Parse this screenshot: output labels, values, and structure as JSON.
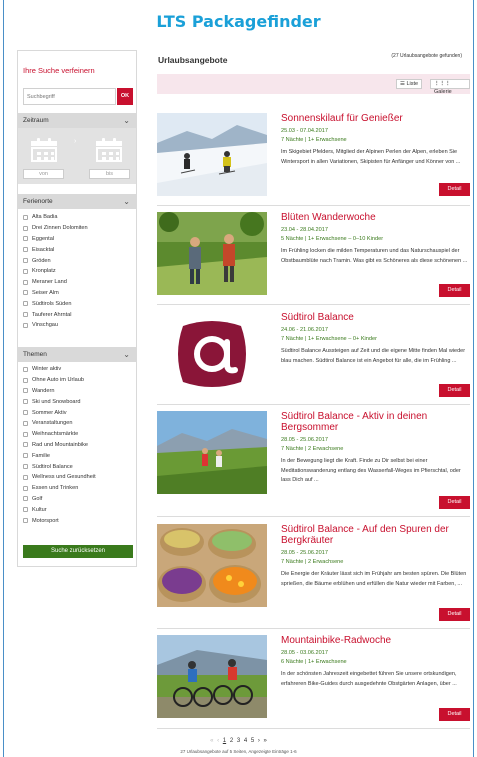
{
  "app_title": "LTS Packagefinder",
  "sidebar": {
    "refine_title": "Ihre Suche verfeinern",
    "search_placeholder": "Suchbegriff",
    "search_button": "OK",
    "period_label": "Zeitraum",
    "date_from": "von",
    "date_to": "bis",
    "regions_label": "Ferienorte",
    "regions": [
      "Alta Badia",
      "Drei Zinnen Dolomiten",
      "Eggental",
      "Eisacktal",
      "Gröden",
      "Kronplatz",
      "Meraner Land",
      "Seiser Alm",
      "Südtirols Süden",
      "Tauferer Ahrntal",
      "Vinschgau"
    ],
    "themes_label": "Themen",
    "themes": [
      "Winter aktiv",
      "Ohne Auto im Urlaub",
      "Wandern",
      "Ski und Snowboard",
      "Sommer Aktiv",
      "Veranstaltungen",
      "Weihnachtsmärkte",
      "Rad und Mountainbike",
      "Familie",
      "Südtirol Balance",
      "Wellness und Gesundheit",
      "Essen und Trinken",
      "Golf",
      "Kultur",
      "Motorsport"
    ],
    "reset_button": "Suche zurücksetzen"
  },
  "main": {
    "title": "Urlaubsangebote",
    "count_text": "(27 Urlaubsangebote gefunden)",
    "view_list": "Liste",
    "view_gallery": "Galerie",
    "detail_label": "Detail",
    "offers": [
      {
        "title": "Sonnenskilauf für Genießer",
        "dates": "25.03 - 07.04.2017",
        "persons": "7 Nächte | 1+ Erwachsene",
        "desc": "Im Skigebiet Pfelders, Mitglied der Alpinen Perlen der Alpen, erleben Sie Wintersport in allen Variationen, Skipisten für Anfänger und Könner von ..."
      },
      {
        "title": "Blüten Wanderwoche",
        "dates": "23.04 - 28.04.2017",
        "persons": "5 Nächte | 1+ Erwachsene – 0–10 Kinder",
        "desc": "Im Frühling locken die milden Temperaturen und das Naturschauspiel der Obstbaumblüte nach Tramin. Was gibt es Schöneres als diese schönenen ..."
      },
      {
        "title": "Südtirol Balance",
        "dates": "24.06 - 21.06.2017",
        "persons": "7 Nächte | 1+ Erwachsene – 0+ Kinder",
        "desc": "Südtirol Balance Aussteigen auf Zeit und die eigene Mitte finden Mal wieder blau machen. Südtirol Balance ist ein Angebot für alle, die im Frühling ..."
      },
      {
        "title": "Südtirol Balance - Aktiv in deinen Bergsommer",
        "dates": "28.05 - 25.06.2017",
        "persons": "7 Nächte | 2 Erwachsene",
        "desc": "In der Bewegung liegt die Kraft. Finde zu Dir selbst bei einer Meditationswanderung entlang des Wasserfall-Weges im Pfierschtal, oder lass Dich auf ..."
      },
      {
        "title": "Südtirol Balance - Auf den Spuren der Bergkräuter",
        "dates": "28.05 - 25.06.2017",
        "persons": "7 Nächte | 2 Erwachsene",
        "desc": "Die Energie der Kräuter lässt sich im Frühjahr am besten spüren. Die Blüten sprießen, die Bäume erblühen und erfüllen die Natur wieder mit Farben, ..."
      },
      {
        "title": "Mountainbike-Radwoche",
        "dates": "28.05 - 03.06.2017",
        "persons": "6 Nächte | 1+ Erwachsene",
        "desc": "In der schönsten Jahreszeit eingebettet führen Sie unsere ortskundigen, erfahreren Bike-Guides durch ausgedehnte Obstgärten Anlagen, über ..."
      }
    ]
  },
  "pager": {
    "prev_first": "«",
    "prev": "‹",
    "pages": [
      "1",
      "2",
      "3",
      "4",
      "5"
    ],
    "next": "›",
    "next_last": "»",
    "info": "27 Urlaubsangebote auf 5 Seiten, Angezeigte Einträge 1-6"
  }
}
